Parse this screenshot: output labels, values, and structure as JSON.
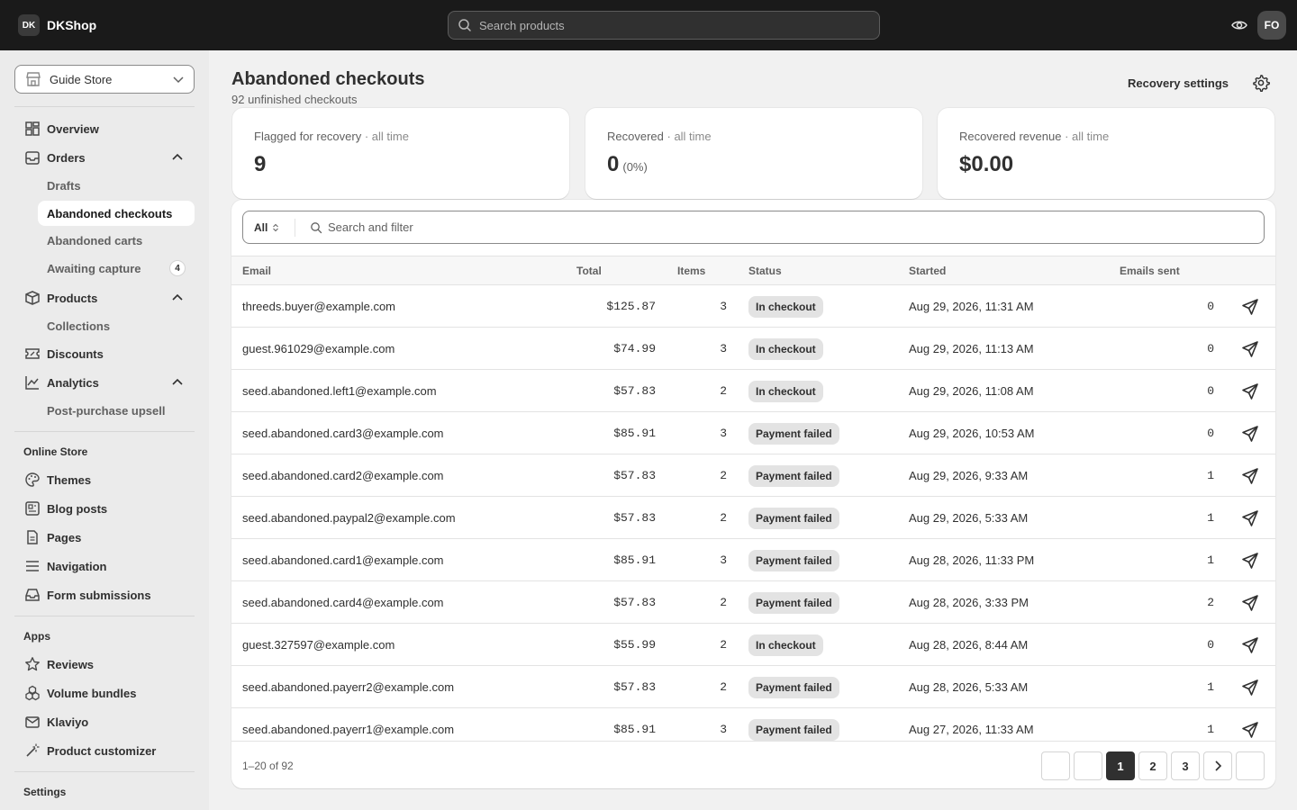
{
  "topbar": {
    "logo_badge": "DK",
    "logo_text": "DKShop",
    "search_placeholder": "Search products",
    "avatar_initials": "FO"
  },
  "sidebar": {
    "store_name": "Guide Store",
    "nav": {
      "overview": "Overview",
      "orders": "Orders",
      "drafts": "Drafts",
      "abandoned_checkouts": "Abandoned checkouts",
      "abandoned_carts": "Abandoned carts",
      "awaiting_capture": "Awaiting capture",
      "awaiting_capture_count": "4",
      "products": "Products",
      "collections": "Collections",
      "discounts": "Discounts",
      "analytics": "Analytics",
      "post_purchase_upsell": "Post-purchase upsell"
    },
    "online_store": {
      "title": "Online Store",
      "themes": "Themes",
      "blog_posts": "Blog posts",
      "pages": "Pages",
      "navigation": "Navigation",
      "form_submissions": "Form submissions"
    },
    "apps": {
      "title": "Apps",
      "reviews": "Reviews",
      "volume_bundles": "Volume bundles",
      "klaviyo": "Klaviyo",
      "product_customizer": "Product customizer"
    },
    "settings": "Settings"
  },
  "header": {
    "title": "Abandoned checkouts",
    "subtitle": "92 unfinished checkouts",
    "recovery_settings": "Recovery settings"
  },
  "stats": [
    {
      "label": "Flagged for recovery",
      "period": "· all time",
      "value": "9",
      "pct": ""
    },
    {
      "label": "Recovered",
      "period": "· all time",
      "value": "0",
      "pct": "(0%)"
    },
    {
      "label": "Recovered revenue",
      "period": "· all time",
      "value": "$0.00",
      "pct": ""
    }
  ],
  "filter": {
    "view": "All",
    "placeholder": "Search and filter"
  },
  "table": {
    "columns": [
      "Email",
      "Total",
      "Items",
      "Status",
      "Started",
      "Emails sent"
    ],
    "rows": [
      {
        "email": "threeds.buyer@example.com",
        "total": "$125.87",
        "items": "3",
        "status": "In checkout",
        "started": "Aug 29, 2026, 11:31 AM",
        "emails": "0"
      },
      {
        "email": "guest.961029@example.com",
        "total": "$74.99",
        "items": "3",
        "status": "In checkout",
        "started": "Aug 29, 2026, 11:13 AM",
        "emails": "0"
      },
      {
        "email": "seed.abandoned.left1@example.com",
        "total": "$57.83",
        "items": "2",
        "status": "In checkout",
        "started": "Aug 29, 2026, 11:08 AM",
        "emails": "0"
      },
      {
        "email": "seed.abandoned.card3@example.com",
        "total": "$85.91",
        "items": "3",
        "status": "Payment failed",
        "started": "Aug 29, 2026, 10:53 AM",
        "emails": "0"
      },
      {
        "email": "seed.abandoned.card2@example.com",
        "total": "$57.83",
        "items": "2",
        "status": "Payment failed",
        "started": "Aug 29, 2026, 9:33 AM",
        "emails": "1"
      },
      {
        "email": "seed.abandoned.paypal2@example.com",
        "total": "$57.83",
        "items": "2",
        "status": "Payment failed",
        "started": "Aug 29, 2026, 5:33 AM",
        "emails": "1"
      },
      {
        "email": "seed.abandoned.card1@example.com",
        "total": "$85.91",
        "items": "3",
        "status": "Payment failed",
        "started": "Aug 28, 2026, 11:33 PM",
        "emails": "1"
      },
      {
        "email": "seed.abandoned.card4@example.com",
        "total": "$57.83",
        "items": "2",
        "status": "Payment failed",
        "started": "Aug 28, 2026, 3:33 PM",
        "emails": "2"
      },
      {
        "email": "guest.327597@example.com",
        "total": "$55.99",
        "items": "2",
        "status": "In checkout",
        "started": "Aug 28, 2026, 8:44 AM",
        "emails": "0"
      },
      {
        "email": "seed.abandoned.payerr2@example.com",
        "total": "$57.83",
        "items": "2",
        "status": "Payment failed",
        "started": "Aug 28, 2026, 5:33 AM",
        "emails": "1"
      },
      {
        "email": "seed.abandoned.payerr1@example.com",
        "total": "$85.91",
        "items": "3",
        "status": "Payment failed",
        "started": "Aug 27, 2026, 11:33 AM",
        "emails": "1"
      }
    ]
  },
  "pagination": {
    "range": "1–20 of 92",
    "pages": [
      "1",
      "2",
      "3"
    ],
    "current": "1"
  }
}
